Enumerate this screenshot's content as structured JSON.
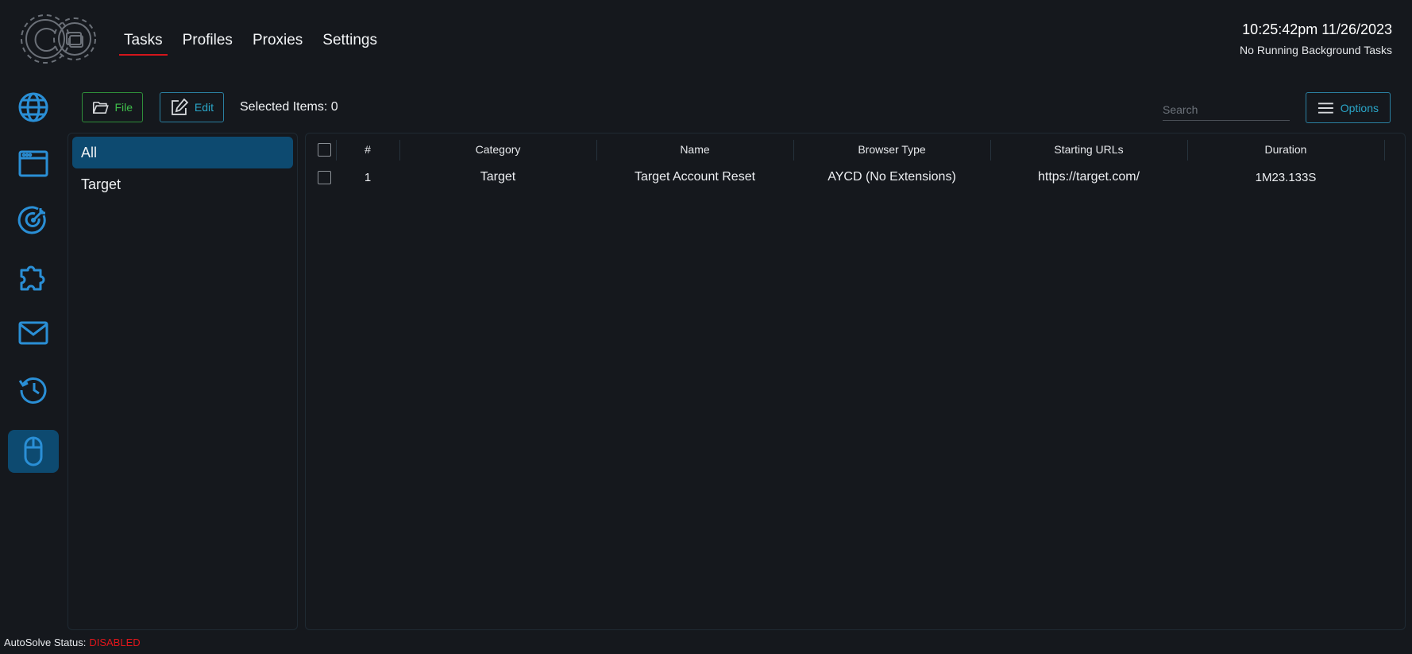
{
  "nav": {
    "tabs": [
      {
        "label": "Tasks",
        "active": true
      },
      {
        "label": "Profiles",
        "active": false
      },
      {
        "label": "Proxies",
        "active": false
      },
      {
        "label": "Settings",
        "active": false
      }
    ]
  },
  "header": {
    "clock": "10:25:42pm 11/26/2023",
    "background_status": "No Running Background Tasks"
  },
  "sidebar": {
    "items": [
      {
        "icon": "globe-icon",
        "active": false
      },
      {
        "icon": "browser-window-icon",
        "active": false
      },
      {
        "icon": "target-icon",
        "active": false
      },
      {
        "icon": "puzzle-icon",
        "active": false
      },
      {
        "icon": "mail-icon",
        "active": false
      },
      {
        "icon": "history-icon",
        "active": false
      },
      {
        "icon": "mouse-icon",
        "active": true
      }
    ]
  },
  "toolbar": {
    "file_label": "File",
    "edit_label": "Edit",
    "selected_items": "Selected Items: 0",
    "search_placeholder": "Search",
    "options_label": "Options"
  },
  "categories": {
    "items": [
      {
        "label": "All",
        "active": true
      },
      {
        "label": "Target",
        "active": false
      }
    ]
  },
  "table": {
    "headers": [
      "#",
      "Category",
      "Name",
      "Browser Type",
      "Starting URLs",
      "Duration"
    ],
    "rows": [
      {
        "num": "1",
        "category": "Target",
        "name": "Target Account Reset",
        "browser_type": "AYCD (No Extensions)",
        "starting_urls": "https://target.com/",
        "duration": "1M23.133S"
      }
    ]
  },
  "footer": {
    "autosolve_label": "AutoSolve Status:",
    "autosolve_status": "DISABLED"
  },
  "colors": {
    "accent_blue": "#2a8fd6",
    "active_bg": "#0d4a70",
    "file_green": "#3fbe4b",
    "edit_cyan": "#2aa6c8",
    "danger_red": "#e3161b"
  }
}
